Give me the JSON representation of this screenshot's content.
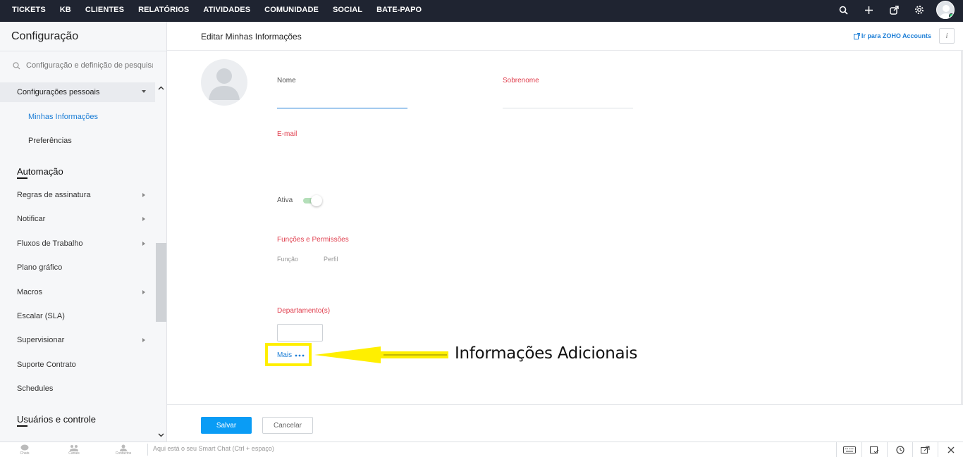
{
  "topnav": [
    "TICKETS",
    "KB",
    "CLIENTES",
    "RELATÓRIOS",
    "ATIVIDADES",
    "COMUNIDADE",
    "SOCIAL",
    "BATE-PAPO"
  ],
  "top_icons": [
    "search-icon",
    "plus-icon",
    "external-link-icon",
    "gear-icon"
  ],
  "sidebar": {
    "title": "Configuração",
    "search_placeholder": "Configuração e definição de pesquisa",
    "section_personal": "Configurações pessoais",
    "personal_items": [
      "Minhas Informações",
      "Preferências"
    ],
    "automation_head": "Automação",
    "automation_items": [
      "Regras de assinatura",
      "Notificar",
      "Fluxos de Trabalho",
      "Plano gráfico",
      "Macros",
      "Escalar (SLA)",
      "Supervisionar",
      "Suporte Contrato",
      "Schedules"
    ],
    "users_head": "Usuários e controle"
  },
  "main": {
    "title": "Editar Minhas Informações",
    "zoho_link": "Ir para ZOHO Accounts",
    "info_label": "i",
    "first_name_label": "Nome",
    "last_name_label": "Sobrenome",
    "email_label": "E-mail",
    "active_label": "Ativa",
    "roles_label": "Funções e Permissões",
    "role_col": "Função",
    "profile_col": "Perfil",
    "department_label": "Departamento(s)",
    "more_label": "Mais",
    "annotation": "Informações Adicionais"
  },
  "footer": {
    "save": "Salvar",
    "cancel": "Cancelar"
  },
  "bottombar": {
    "tabs": [
      "Chats",
      "Canais",
      "Contactos"
    ],
    "chat_placeholder": "Aqui está o seu Smart Chat (Ctrl + espaço)"
  },
  "colors": {
    "topbar": "#1f2431",
    "accent": "#1c7ed6",
    "required": "#e03e4d",
    "save": "#0a9cf5",
    "highlight": "#ffef00"
  }
}
